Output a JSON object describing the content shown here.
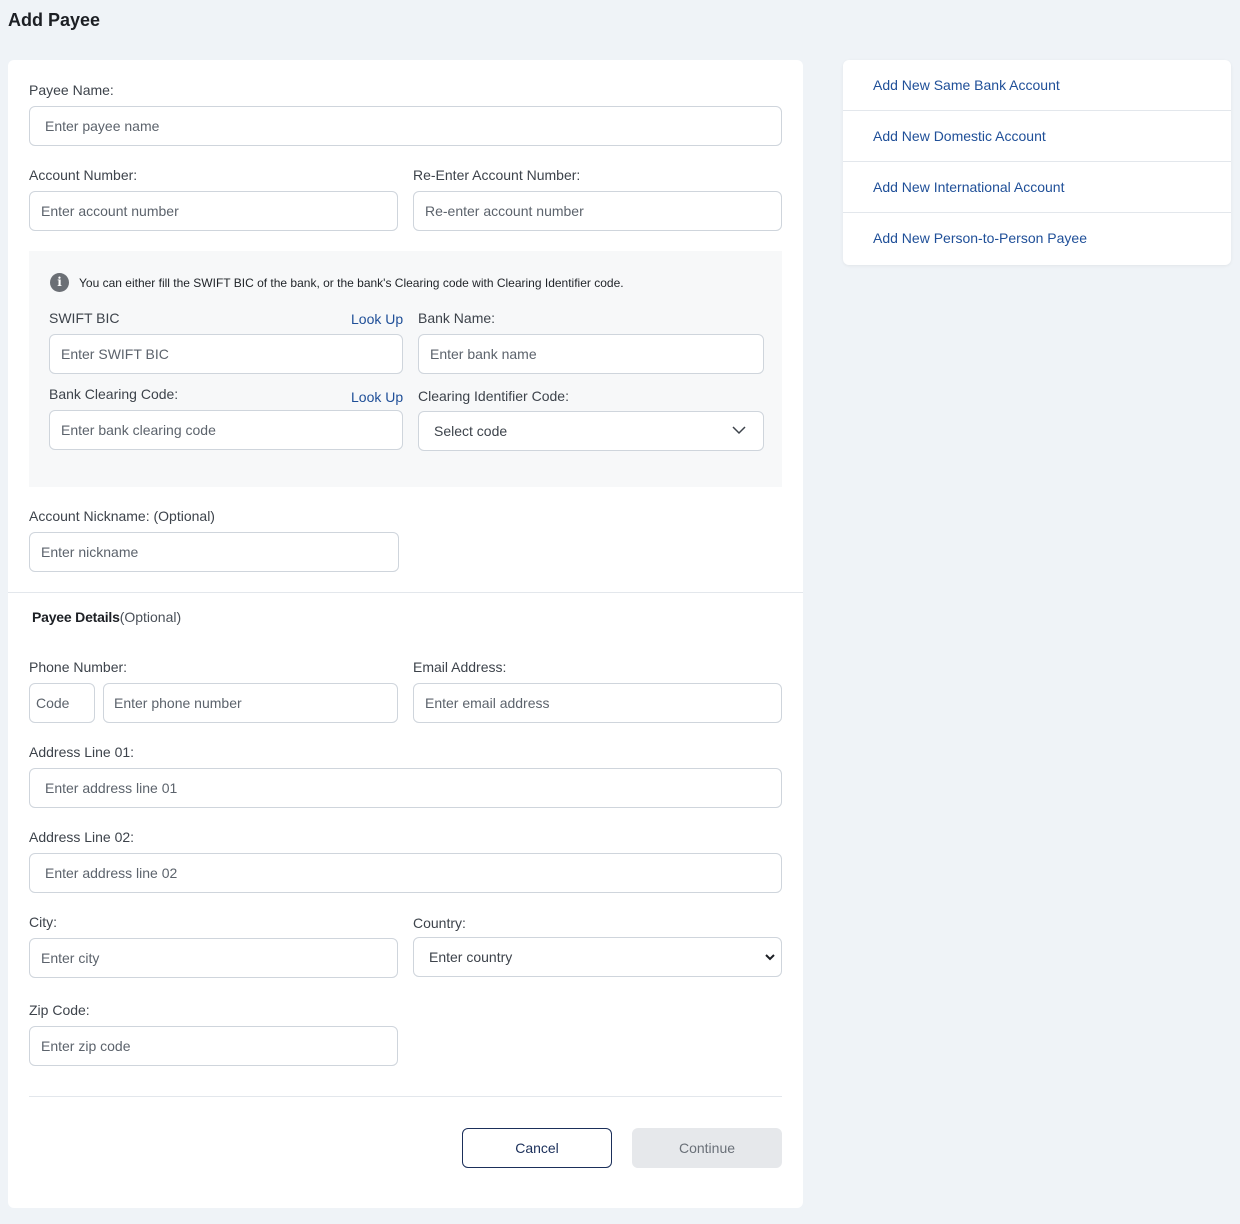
{
  "page": {
    "title": "Add Payee"
  },
  "form": {
    "payee_name": {
      "label": "Payee Name:",
      "placeholder": "Enter payee name"
    },
    "account_number": {
      "label": "Account Number:",
      "placeholder": "Enter account number"
    },
    "reenter_account_number": {
      "label": "Re-Enter Account Number:",
      "placeholder": "Re-enter account number"
    },
    "bank_info": {
      "note": "You can either fill the SWIFT BIC of the bank, or the bank's Clearing code with Clearing Identifier code.",
      "info_icon": "info-icon",
      "swift_bic": {
        "label": "SWIFT BIC",
        "placeholder": "Enter SWIFT BIC",
        "lookup": "Look Up"
      },
      "bank_name": {
        "label": "Bank Name:",
        "placeholder": "Enter bank name"
      },
      "clearing_code": {
        "label": "Bank Clearing Code:",
        "placeholder": "Enter bank clearing code",
        "lookup": "Look Up"
      },
      "clearing_identifier": {
        "label": "Clearing Identifier Code:",
        "selected": "Select code"
      }
    },
    "nickname": {
      "label": "Account Nickname: (Optional)",
      "placeholder": "Enter nickname"
    },
    "payee_details": {
      "heading": "Payee Details",
      "heading_suffix": "(Optional)",
      "phone": {
        "label": "Phone Number:",
        "code_placeholder": "Code",
        "placeholder": "Enter phone number"
      },
      "email": {
        "label": "Email Address:",
        "placeholder": "Enter email address"
      },
      "address1": {
        "label": "Address Line 01:",
        "placeholder": "Enter address line 01"
      },
      "address2": {
        "label": "Address Line 02:",
        "placeholder": "Enter address line 02"
      },
      "city": {
        "label": "City:",
        "placeholder": "Enter city"
      },
      "country": {
        "label": "Country:",
        "selected": "Enter country"
      },
      "zip": {
        "label": "Zip Code:",
        "placeholder": "Enter zip code"
      }
    },
    "actions": {
      "cancel": "Cancel",
      "continue": "Continue"
    }
  },
  "sidebar": {
    "items": [
      {
        "label": "Add New Same Bank Account"
      },
      {
        "label": "Add New Domestic Account"
      },
      {
        "label": "Add New International Account"
      },
      {
        "label": "Add New Person-to-Person Payee"
      }
    ]
  },
  "colors": {
    "page_background": "#eff3f7",
    "link": "#1f4f98",
    "cancel_border": "#1b2f5a",
    "continue_disabled": "#e6e8eb"
  }
}
